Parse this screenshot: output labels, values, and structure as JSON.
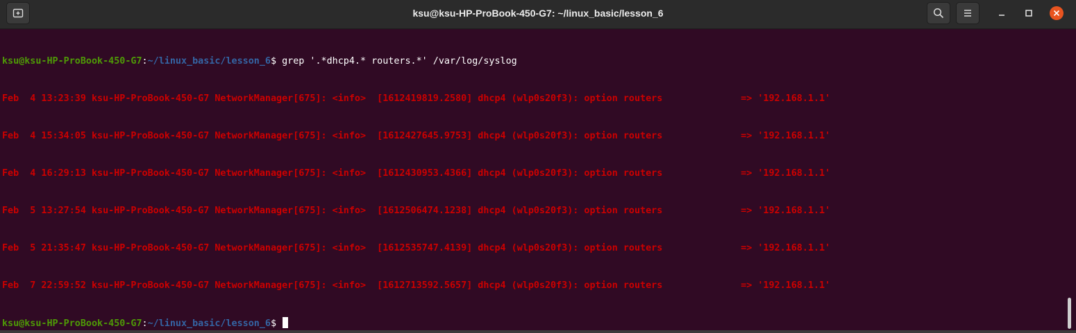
{
  "window": {
    "title": "ksu@ksu-HP-ProBook-450-G7: ~/linux_basic/lesson_6"
  },
  "icons": {
    "new_tab": "new-tab-icon",
    "search": "search-icon",
    "menu": "hamburger-menu-icon",
    "minimize": "minimize-icon",
    "maximize": "maximize-icon",
    "close": "close-icon"
  },
  "colors": {
    "background": "#300a24",
    "prompt_user": "#4e9a06",
    "prompt_path": "#3465a4",
    "log_text": "#cc0000",
    "close_button": "#e95420"
  },
  "terminal": {
    "command_line": {
      "user_host": "ksu@ksu-HP-ProBook-450-G7",
      "colon": ":",
      "path": "~/linux_basic/lesson_6",
      "dollar": "$ ",
      "command": "grep '.*dhcp4.* routers.*' /var/log/syslog"
    },
    "output": [
      "Feb  4 13:23:39 ksu-HP-ProBook-450-G7 NetworkManager[675]: <info>  [1612419819.2580] dhcp4 (wlp0s20f3): option routers              => '192.168.1.1'",
      "Feb  4 15:34:05 ksu-HP-ProBook-450-G7 NetworkManager[675]: <info>  [1612427645.9753] dhcp4 (wlp0s20f3): option routers              => '192.168.1.1'",
      "Feb  4 16:29:13 ksu-HP-ProBook-450-G7 NetworkManager[675]: <info>  [1612430953.4366] dhcp4 (wlp0s20f3): option routers              => '192.168.1.1'",
      "Feb  5 13:27:54 ksu-HP-ProBook-450-G7 NetworkManager[675]: <info>  [1612506474.1238] dhcp4 (wlp0s20f3): option routers              => '192.168.1.1'",
      "Feb  5 21:35:47 ksu-HP-ProBook-450-G7 NetworkManager[675]: <info>  [1612535747.4139] dhcp4 (wlp0s20f3): option routers              => '192.168.1.1'",
      "Feb  7 22:59:52 ksu-HP-ProBook-450-G7 NetworkManager[675]: <info>  [1612713592.5657] dhcp4 (wlp0s20f3): option routers              => '192.168.1.1'"
    ],
    "prompt_line": {
      "user_host": "ksu@ksu-HP-ProBook-450-G7",
      "colon": ":",
      "path": "~/linux_basic/lesson_6",
      "dollar": "$ "
    }
  }
}
